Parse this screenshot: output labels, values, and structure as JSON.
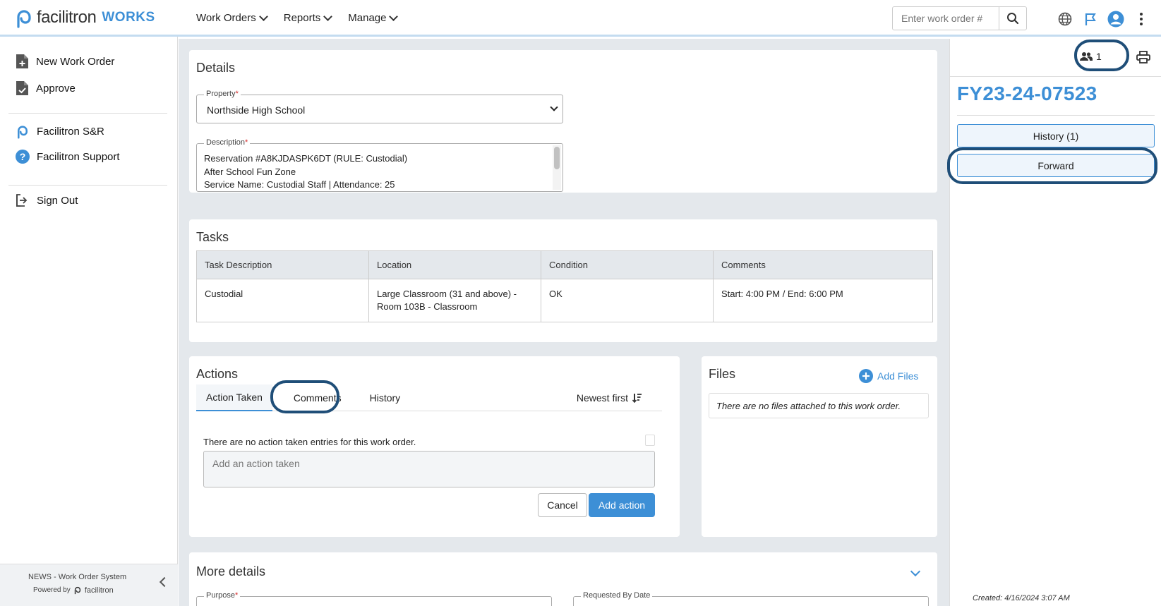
{
  "brand": {
    "name": "facilitron",
    "product": "WORKS",
    "accent": "#3d8fd6"
  },
  "nav": {
    "items": [
      {
        "label": "Work Orders"
      },
      {
        "label": "Reports"
      },
      {
        "label": "Manage"
      }
    ]
  },
  "search": {
    "placeholder": "Enter work order #",
    "icon": "search-icon"
  },
  "top_icons": [
    "globe-icon",
    "flag-icon",
    "user-avatar-icon",
    "more-vertical-icon"
  ],
  "sidebar": {
    "items": [
      {
        "label": "New Work Order",
        "icon": "file-plus-icon"
      },
      {
        "label": "Approve",
        "icon": "file-check-icon"
      },
      {
        "label": "Facilitron S&R",
        "icon": "facilitron-logo-icon"
      },
      {
        "label": "Facilitron Support",
        "icon": "help-circle-icon"
      },
      {
        "label": "Sign Out",
        "icon": "sign-out-icon"
      }
    ],
    "footer": {
      "system": "NEWS - Work Order System",
      "powered_by": "Powered by",
      "powered_brand": "facilitron"
    }
  },
  "details": {
    "title": "Details",
    "property": {
      "label": "Property",
      "value": "Northside High School"
    },
    "description": {
      "label": "Description",
      "lines": [
        "Reservation #A8KJDASPK6DT (RULE: Custodial)",
        "After School Fun Zone",
        "Service Name: Custodial Staff | Attendance: 25"
      ]
    }
  },
  "tasks": {
    "title": "Tasks",
    "columns": [
      "Task Description",
      "Location",
      "Condition",
      "Comments"
    ],
    "rows": [
      {
        "description": "Custodial",
        "location_line1": "Large Classroom (31 and above) -",
        "location_line2": "Room 103B - Classroom",
        "condition": "OK",
        "comments": "Start: 4:00 PM / End: 6:00 PM"
      }
    ]
  },
  "actions": {
    "title": "Actions",
    "tabs": [
      {
        "label": "Action Taken",
        "active": true
      },
      {
        "label": "Comments"
      },
      {
        "label": "History"
      }
    ],
    "sort_label": "Newest first",
    "empty_text": "There are no action taken entries for this work order.",
    "input_placeholder": "Add an action taken",
    "cancel_label": "Cancel",
    "add_label": "Add action"
  },
  "files": {
    "title": "Files",
    "add_label": "Add Files",
    "empty_text": "There are no files attached to this work order."
  },
  "more_details": {
    "title": "More details",
    "purpose_label": "Purpose",
    "requested_by_label": "Requested By Date"
  },
  "right_panel": {
    "watchers_count": "1",
    "work_order_number": "FY23-24-07523",
    "history_label": "History (1)",
    "forward_label": "Forward",
    "created": "Created: 4/16/2024 3:07 AM"
  }
}
